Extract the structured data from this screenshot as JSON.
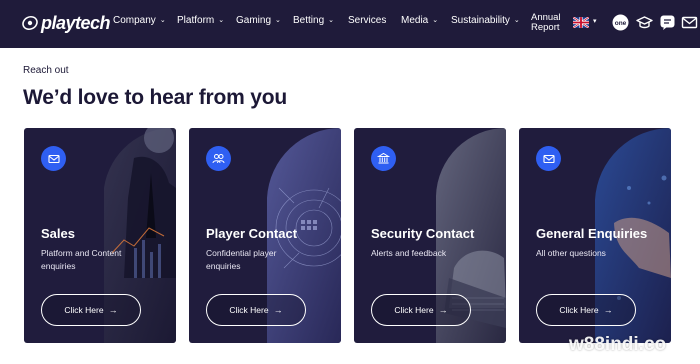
{
  "brand": {
    "logo_text": "playtech"
  },
  "nav": {
    "items": [
      {
        "label": "Company",
        "has_dropdown": true
      },
      {
        "label": "Platform",
        "has_dropdown": true
      },
      {
        "label": "Gaming",
        "has_dropdown": true
      },
      {
        "label": "Betting",
        "has_dropdown": true
      },
      {
        "label": "Services",
        "has_dropdown": false
      },
      {
        "label": "Media",
        "has_dropdown": true
      },
      {
        "label": "Sustainability",
        "has_dropdown": true
      }
    ],
    "annual_report": {
      "line1": "Annual",
      "line2": "Report"
    },
    "language": "UK flag",
    "icons": [
      "one-icon",
      "graduation-cap-icon",
      "speech-bubble-icon",
      "envelope-icon"
    ],
    "one_label": "one"
  },
  "section": {
    "eyebrow": "Reach out",
    "headline": "We’d love to hear from you"
  },
  "cards": [
    {
      "title": "Sales",
      "description": "Platform and Content enquiries",
      "button": "Click Here",
      "icon": "envelope-icon"
    },
    {
      "title": "Player Contact",
      "description": "Confidential player enquiries",
      "button": "Click Here",
      "icon": "people-icon"
    },
    {
      "title": "Security Contact",
      "description": "Alerts and feedback",
      "button": "Click Here",
      "icon": "bank-icon"
    },
    {
      "title": "General Enquiries",
      "description": "All other questions",
      "button": "Click Here",
      "icon": "envelope-icon"
    }
  ],
  "watermark": "w88indi.co",
  "colors": {
    "topbar": "#1f1b3a",
    "card_bg": "#201c3d",
    "accent": "#2f5ff2",
    "text_dark": "#1c1836"
  }
}
